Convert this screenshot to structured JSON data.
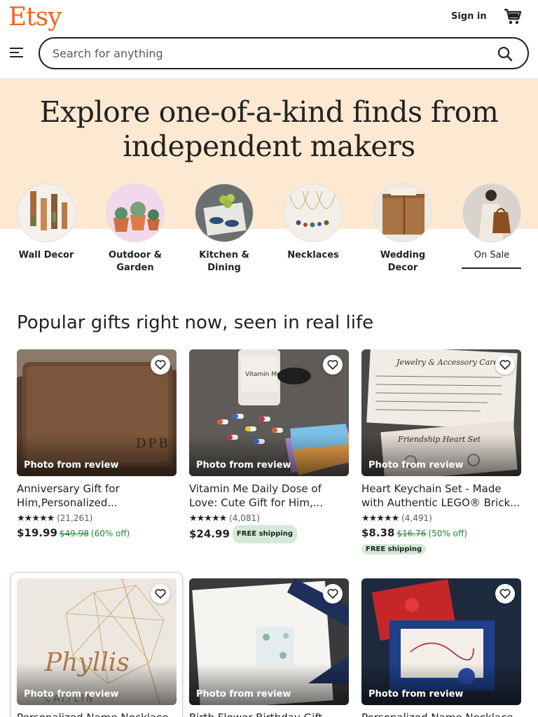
{
  "header": {
    "logo": "Etsy",
    "sign_in": "Sign in",
    "search_placeholder": "Search for anything"
  },
  "hero": {
    "title_line1": "Explore one-of-a-kind finds from",
    "title_line2": "independent makers"
  },
  "categories": [
    {
      "line1": "Wall Decor",
      "line2": ""
    },
    {
      "line1": "Outdoor &",
      "line2": "Garden"
    },
    {
      "line1": "Kitchen &",
      "line2": "Dining"
    },
    {
      "line1": "Necklaces",
      "line2": ""
    },
    {
      "line1": "Wedding",
      "line2": "Decor"
    },
    {
      "line1": "On Sale",
      "line2": "",
      "selected": true
    }
  ],
  "section": {
    "title": "Popular gifts right now, seen in real life"
  },
  "products": [
    {
      "review_label": "Photo from review",
      "title": "Anniversary Gift for Him,Personalized...",
      "stars": "★★★★★",
      "reviews": "(21,261)",
      "price": "$19.99",
      "old_price": "$49.98",
      "discount": "(60% off)",
      "shipping": ""
    },
    {
      "review_label": "Photo from review",
      "title": "Vitamin Me Daily Dose of Love: Cute Gift for Him,...",
      "stars": "★★★★★",
      "reviews": "(4,081)",
      "price": "$24.99",
      "old_price": "",
      "discount": "",
      "shipping": "FREE shipping"
    },
    {
      "review_label": "Photo from review",
      "title": "Heart Keychain Set - Made with Authentic LEGO® Brick...",
      "stars": "★★★★★",
      "reviews": "(4,491)",
      "price": "$8.38",
      "old_price": "$16.76",
      "discount": "(50% off)",
      "shipping": "FREE shipping"
    },
    {
      "review_label": "Photo from review",
      "title": "Personalized Name Necklace"
    },
    {
      "review_label": "Photo from review",
      "title": "Birth Flower Birthday Gift"
    },
    {
      "review_label": "Photo from review",
      "title": "Personalized Name Necklace"
    }
  ],
  "colors": {
    "brand": "#f1641e",
    "hero_bg": "#fde9d2",
    "sale_green": "#258635",
    "shipping_badge": "#d4e9d7"
  },
  "icons": [
    "menu-icon",
    "search-icon",
    "cart-icon",
    "heart-icon"
  ]
}
